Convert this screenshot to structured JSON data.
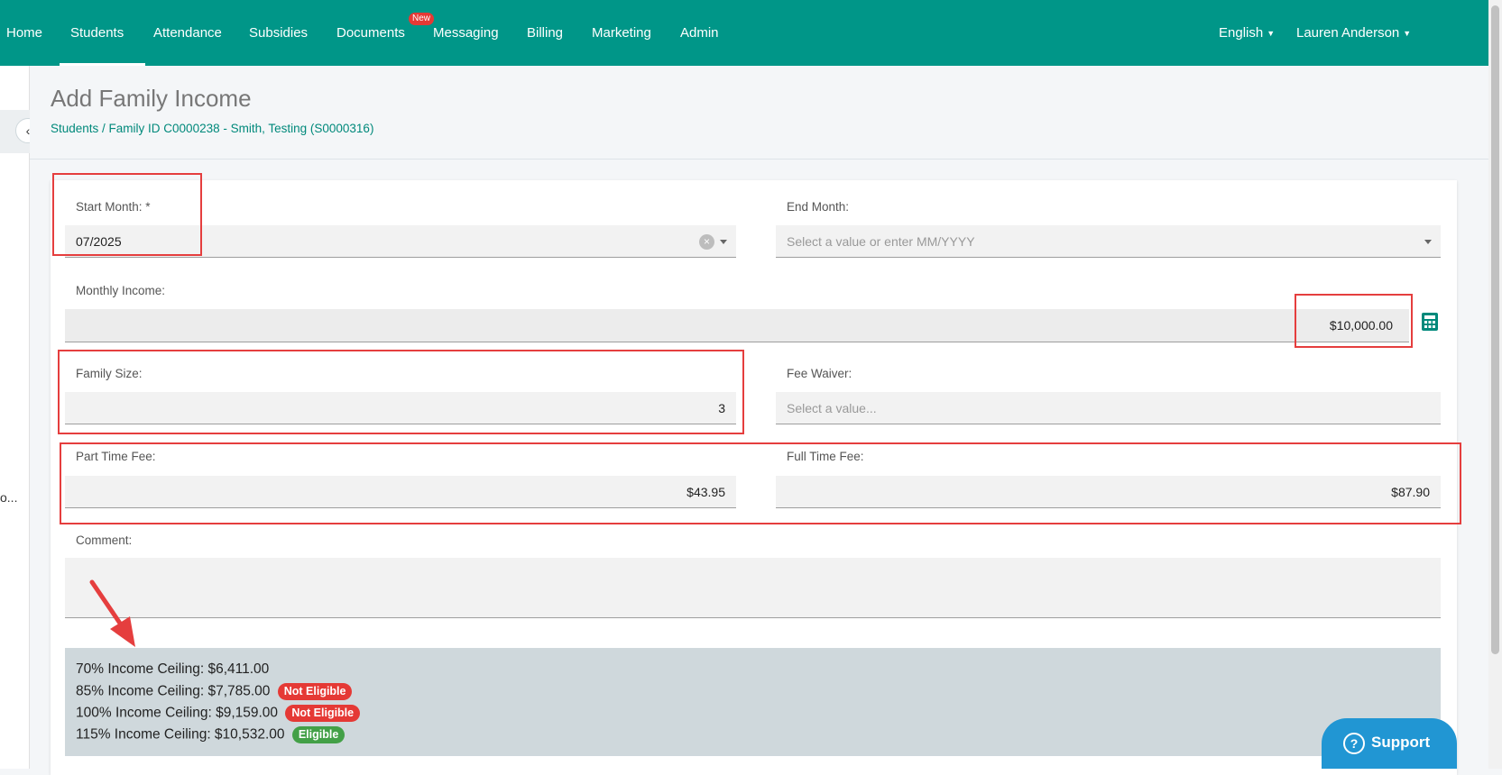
{
  "nav": {
    "items": [
      "Home",
      "Students",
      "Attendance",
      "Subsidies",
      "Documents",
      "Messaging",
      "Billing",
      "Marketing",
      "Admin"
    ],
    "active": "Students",
    "new_badge": "New",
    "language": "English",
    "user": "Lauren Anderson"
  },
  "sidebar": {
    "truncated_text": "o..."
  },
  "page": {
    "title": "Add Family Income",
    "breadcrumb": "Students / Family ID C0000238 - Smith, Testing (S0000316)"
  },
  "form": {
    "start_month": {
      "label": "Start Month: *",
      "value": "07/2025"
    },
    "end_month": {
      "label": "End Month:",
      "placeholder": "Select a value or enter MM/YYYY"
    },
    "monthly_income": {
      "label": "Monthly Income:",
      "value": "$10,000.00"
    },
    "family_size": {
      "label": "Family Size:",
      "value": "3"
    },
    "fee_waiver": {
      "label": "Fee Waiver:",
      "placeholder": "Select a value..."
    },
    "part_time_fee": {
      "label": "Part Time Fee:",
      "value": "$43.95"
    },
    "full_time_fee": {
      "label": "Full Time Fee:",
      "value": "$87.90"
    },
    "comment": {
      "label": "Comment:",
      "value": ""
    }
  },
  "ceilings": [
    {
      "text": "70% Income Ceiling: $6,411.00",
      "status": ""
    },
    {
      "text": "85% Income Ceiling: $7,785.00",
      "status": "Not Eligible"
    },
    {
      "text": "100% Income Ceiling: $9,159.00",
      "status": "Not Eligible"
    },
    {
      "text": "115% Income Ceiling: $10,532.00",
      "status": "Eligible"
    }
  ],
  "support": {
    "label": "Support"
  },
  "colors": {
    "nav_bg": "#009688",
    "annotation_red": "#e53e3e",
    "not_eligible": "#e53935",
    "eligible": "#43a047",
    "support": "#2196d3"
  },
  "icons": [
    "chevron-left-icon",
    "clear-icon",
    "dropdown-caret-icon",
    "calculator-icon",
    "help-icon",
    "arrow-annotation"
  ]
}
